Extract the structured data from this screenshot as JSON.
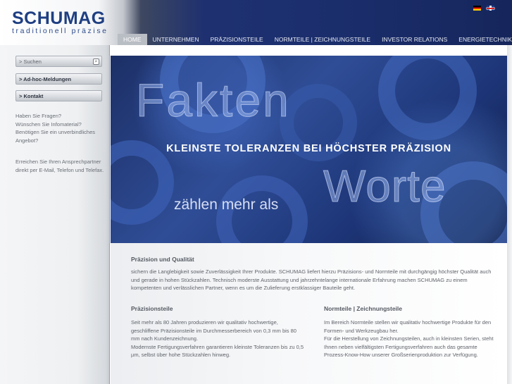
{
  "brand": {
    "name": "SCHUMAG",
    "tagline": "traditionell präzise"
  },
  "languages": [
    "de-flag-icon",
    "en-flag-icon"
  ],
  "nav": {
    "items": [
      {
        "label": "HOME",
        "active": true
      },
      {
        "label": "UNTERNEHMEN",
        "active": false
      },
      {
        "label": "PRÄZISIONSTEILE",
        "active": false
      },
      {
        "label": "NORMTEILE | ZEICHNUNGSTEILE",
        "active": false
      },
      {
        "label": "INVESTOR RELATIONS",
        "active": false
      },
      {
        "label": "ENERGIETECHNIK",
        "active": false
      }
    ]
  },
  "sidebar": {
    "search_placeholder": "> Suchen",
    "buttons": [
      {
        "label": "> Ad-hoc-Meldungen"
      },
      {
        "label": "> Kontakt"
      }
    ],
    "text_1": "Haben Sie Fragen?\nWünschen Sie Infomaterial?\nBenötigen Sie ein unverbindliches Angebot?",
    "text_2": "Erreichen Sie Ihren Ansprechpartner direkt per E-Mail, Telefon und Telefax."
  },
  "hero": {
    "line_1": "Fakten",
    "line_2": "KLEINSTE TOLERANZEN BEI HÖCHSTER PRÄZISION",
    "line_3": "zählen mehr als",
    "line_4": "Worte"
  },
  "content": {
    "intro_title": "Präzision und Qualität",
    "intro_text": "sichern die Langlebigkeit sowie Zuverlässigkeit Ihrer Produkte. SCHUMAG liefert hierzu Präzisions- und Normteile mit durchgängig höchster Qualität auch und gerade in hohen Stückzahlen. Technisch moderste Ausstattung und jahrzehntelange internationale Erfahrung machen SCHUMAG zu einem kompetenten und verlässlichen Partner, wenn es um die Zulieferung erstklassiger Bauteile geht.",
    "col1_title": "Präzisionsteile",
    "col1_text": "Seit mehr als 80 Jahren produzieren wir qualitativ hochwertige, geschliffene Präzisionsteile im Durchmesserbereich von 0,3 mm bis 80 mm nach Kundenzeichnung.\nModernste Fertigungsverfahren garantieren kleinste Toleranzen bis zu 0,5 µm, selbst über hohe Stückzahlen hinweg.",
    "col2_title": "Normteile | Zeichnungsteile",
    "col2_text": "Im Bereich Normteile stellen wir qualitativ hochwertige Produkte für den Formen- und Werkzeugbau her.\nFür die Herstellung von Zeichnungsteilen, auch in kleinsten Serien, steht Ihnen neben vielfältigsten Fertigungsverfahren auch das gesamte Prozess-Know-How unserer Großserienproduktion zur Verfügung."
  }
}
